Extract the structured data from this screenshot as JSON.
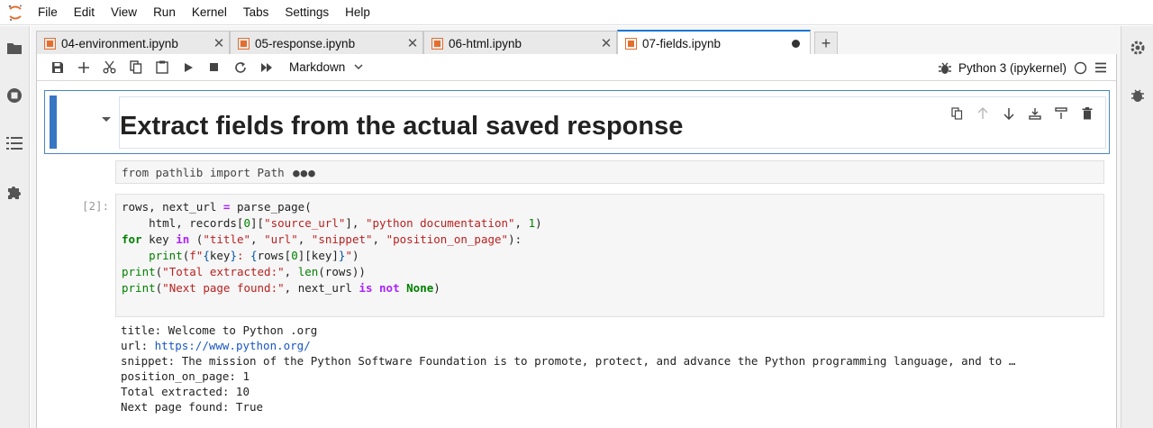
{
  "menu": [
    "File",
    "Edit",
    "View",
    "Run",
    "Kernel",
    "Tabs",
    "Settings",
    "Help"
  ],
  "tabs": [
    {
      "label": "04-environment.ipynb",
      "active": false,
      "dirty": false
    },
    {
      "label": "05-response.ipynb",
      "active": false,
      "dirty": false
    },
    {
      "label": "06-html.ipynb",
      "active": false,
      "dirty": false
    },
    {
      "label": "07-fields.ipynb",
      "active": true,
      "dirty": true
    }
  ],
  "toolbar": {
    "cell_type": "Markdown",
    "kernel_name": "Python 3 (ipykernel)"
  },
  "cells": {
    "heading": "Extract fields from the actual saved response",
    "collapsed_code": "from pathlib import Path",
    "prompt": "[2]:",
    "code_lines": [
      "rows, next_url = parse_page(",
      "    html, records[0][\"source_url\"], \"python documentation\", 1)",
      "for key in (\"title\", \"url\", \"snippet\", \"position_on_page\"):",
      "    print(f\"{key}: {rows[0][key]}\")",
      "print(\"Total extracted:\", len(rows))",
      "print(\"Next page found:\", next_url is not None)"
    ],
    "output": {
      "title_line": "title: Welcome to Python .org",
      "url_prefix": "url: ",
      "url_value": "https://www.python.org/",
      "snippet_line": "snippet: The mission of the Python Software Foundation is to promote, protect, and advance the Python programming language, and to …",
      "position_line": "position_on_page: 1",
      "total_line": "Total extracted: 10",
      "next_line": "Next page found: True"
    }
  },
  "colors": {
    "accent": "#1976d2",
    "collapser": "#3876c4",
    "notebook_icon": "#e46e2e"
  }
}
